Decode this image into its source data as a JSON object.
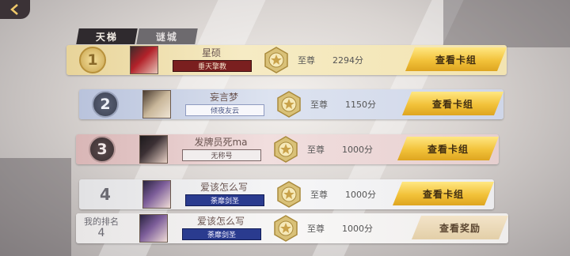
{
  "tabs": [
    {
      "label": "天梯",
      "active": true
    },
    {
      "label": "谜城",
      "active": false
    }
  ],
  "chart_data": {
    "type": "table",
    "columns": [
      "rank",
      "player",
      "title",
      "tier",
      "score",
      "action"
    ],
    "rows": [
      {
        "rank": "1",
        "player": "星硕",
        "title": "垂天擎教",
        "tier": "至尊",
        "score": "2294分",
        "action": "查看卡组"
      },
      {
        "rank": "2",
        "player": "妄言梦",
        "title": "倾夜友云",
        "tier": "至尊",
        "score": "1150分",
        "action": "查看卡组"
      },
      {
        "rank": "3",
        "player": "发牌员死ma",
        "title": "无称号",
        "tier": "至尊",
        "score": "1000分",
        "action": "查看卡组"
      },
      {
        "rank": "4",
        "player": "爱该怎么写",
        "title": "荼靡剑圣",
        "tier": "至尊",
        "score": "1000分",
        "action": "查看卡组"
      }
    ],
    "my_rank": {
      "label": "我的排名",
      "rank": "4",
      "player": "爱该怎么写",
      "title": "荼靡剑圣",
      "tier": "至尊",
      "score": "1000分",
      "action": "查看奖励"
    }
  },
  "colors": {
    "gold": "#f2c23a",
    "row1_bg": "#f3e3a6",
    "row2_bg": "#c9d1e6",
    "row3_bg": "#e8cccc",
    "row4_bg": "#ededee",
    "my_bg": "#f1efee"
  }
}
